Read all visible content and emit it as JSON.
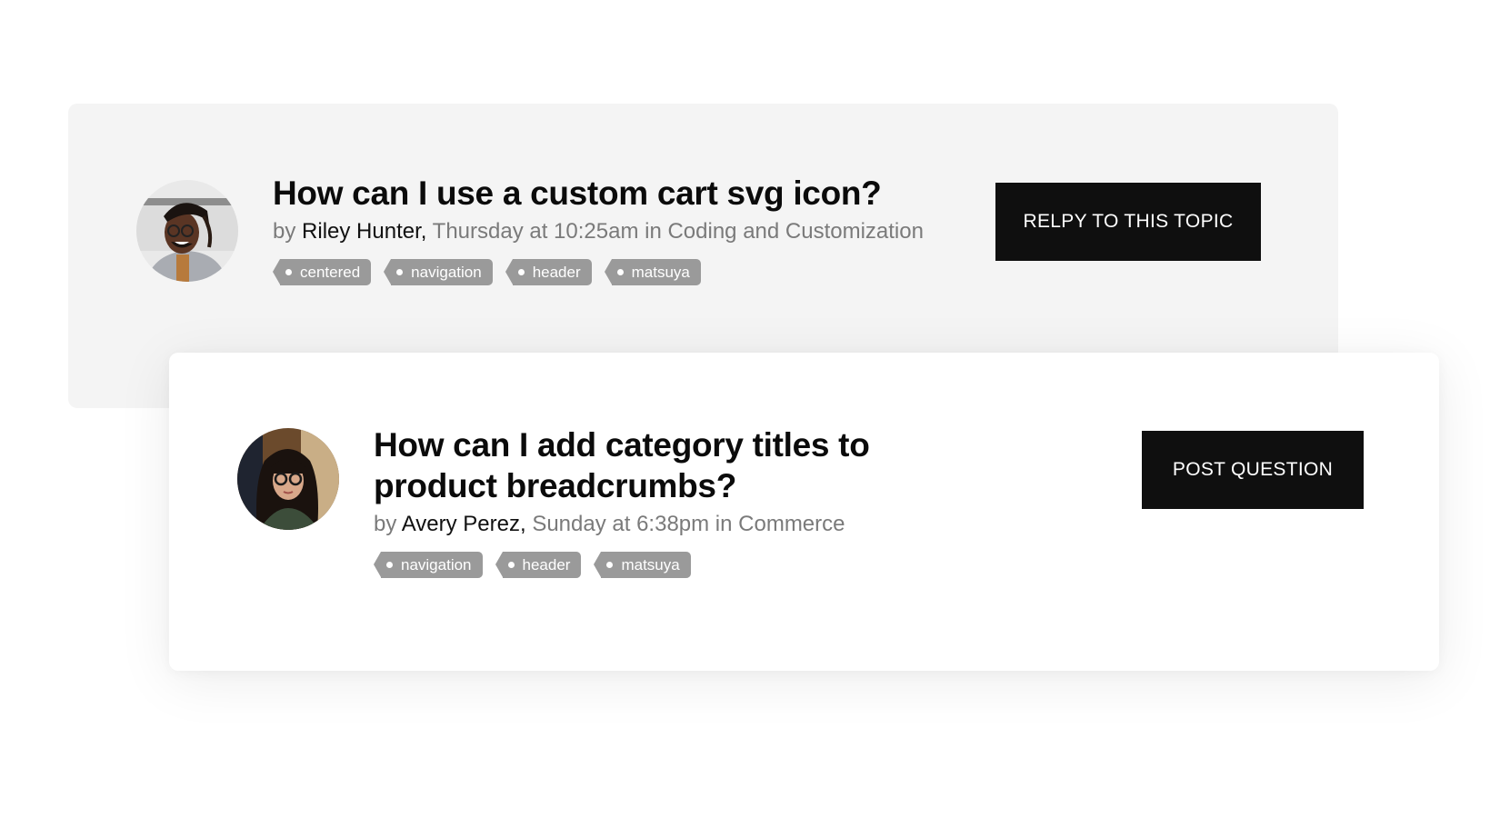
{
  "topics": [
    {
      "title": "How can I use a custom cart svg icon?",
      "by_label": "by",
      "author": "Riley Hunter,",
      "meta": "Thursday at 10:25am in Coding and Customization",
      "tags": [
        "centered",
        "navigation",
        "header",
        "matsuya"
      ],
      "button_label": "RELPY TO THIS TOPIC",
      "avatar": "man-with-glasses-avatar"
    },
    {
      "title": "How can I add category titles to product breadcrumbs?",
      "by_label": "by",
      "author": "Avery Perez,",
      "meta": "Sunday at 6:38pm in Commerce",
      "tags": [
        "navigation",
        "header",
        "matsuya"
      ],
      "button_label": "POST QUESTION",
      "avatar": "woman-with-glasses-avatar"
    }
  ],
  "colors": {
    "button_bg": "#0f0f0f",
    "tag_bg": "#9a9a9a",
    "back_card_bg": "#f4f4f4",
    "meta_text": "#7a7a7a"
  }
}
